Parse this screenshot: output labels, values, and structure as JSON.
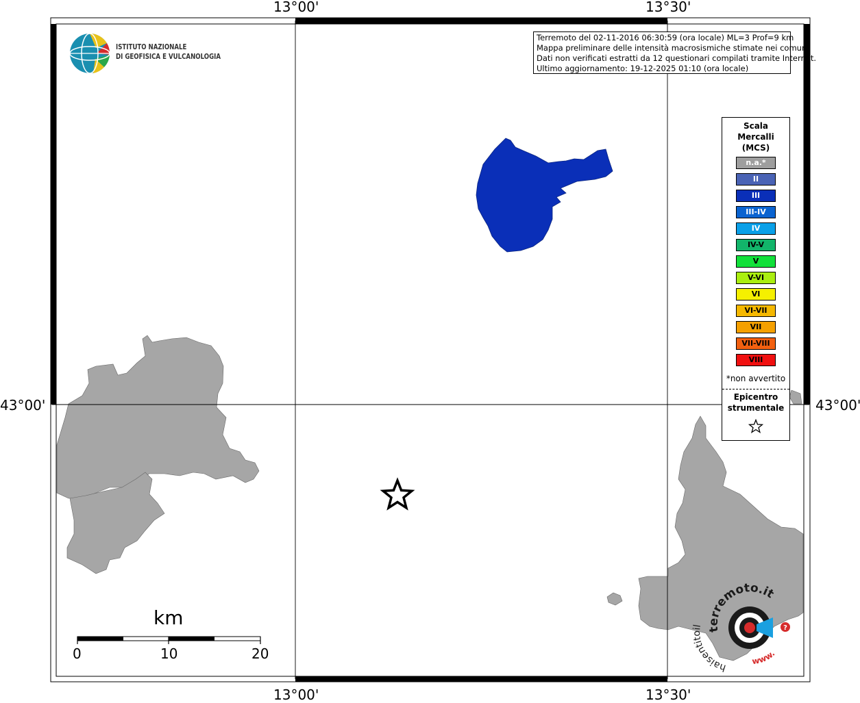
{
  "coordinates": {
    "lon_left": "13°00'",
    "lon_right": "13°30'",
    "lat": "43°00'"
  },
  "institute": {
    "line1": "ISTITUTO NAZIONALE",
    "line2": "DI GEOFISICA E VULCANOLOGIA"
  },
  "info": {
    "line1": "Terremoto del 02-11-2016 06:30:59 (ora locale) ML=3 Prof=9 km",
    "line2": "Mappa preliminare delle intensità macrosismiche stimate nei comuni",
    "line3": "Dati non verificati estratti da 12 questionari compilati tramite Internet.",
    "line4": "Ultimo aggiornamento: 19-12-2025 01:10 (ora locale)"
  },
  "legend": {
    "title_line1": "Scala",
    "title_line2": "Mercalli",
    "title_line3": "(MCS)",
    "classes": [
      {
        "label": "n.a.*",
        "color": "#9e9e9e"
      },
      {
        "label": "II",
        "color": "#4a63b5"
      },
      {
        "label": "III",
        "color": "#0a2fb8"
      },
      {
        "label": "III-IV",
        "color": "#0a63d0"
      },
      {
        "label": "IV",
        "color": "#0aa0e8"
      },
      {
        "label": "IV-V",
        "color": "#12b56a"
      },
      {
        "label": "V",
        "color": "#12e03a"
      },
      {
        "label": "V-VI",
        "color": "#aaee10"
      },
      {
        "label": "VI",
        "color": "#f5f000"
      },
      {
        "label": "VI-VII",
        "color": "#f5b800"
      },
      {
        "label": "VII",
        "color": "#f5a000"
      },
      {
        "label": "VII-VIII",
        "color": "#f26010"
      },
      {
        "label": "VIII",
        "color": "#f01010"
      }
    ],
    "note": "*non avvertito",
    "epicenter_line1": "Epicentro",
    "epicenter_line2": "strumentale"
  },
  "scale_bar": {
    "unit": "km",
    "ticks": [
      "0",
      "10",
      "20"
    ]
  },
  "watermark": {
    "text_top": "terremoto.it",
    "text_side": "haisentitoil",
    "text_bottom": "www."
  },
  "colors": {
    "comune_intensity_III": "#0a2fb8",
    "comune_na": "#a6a6a6"
  }
}
